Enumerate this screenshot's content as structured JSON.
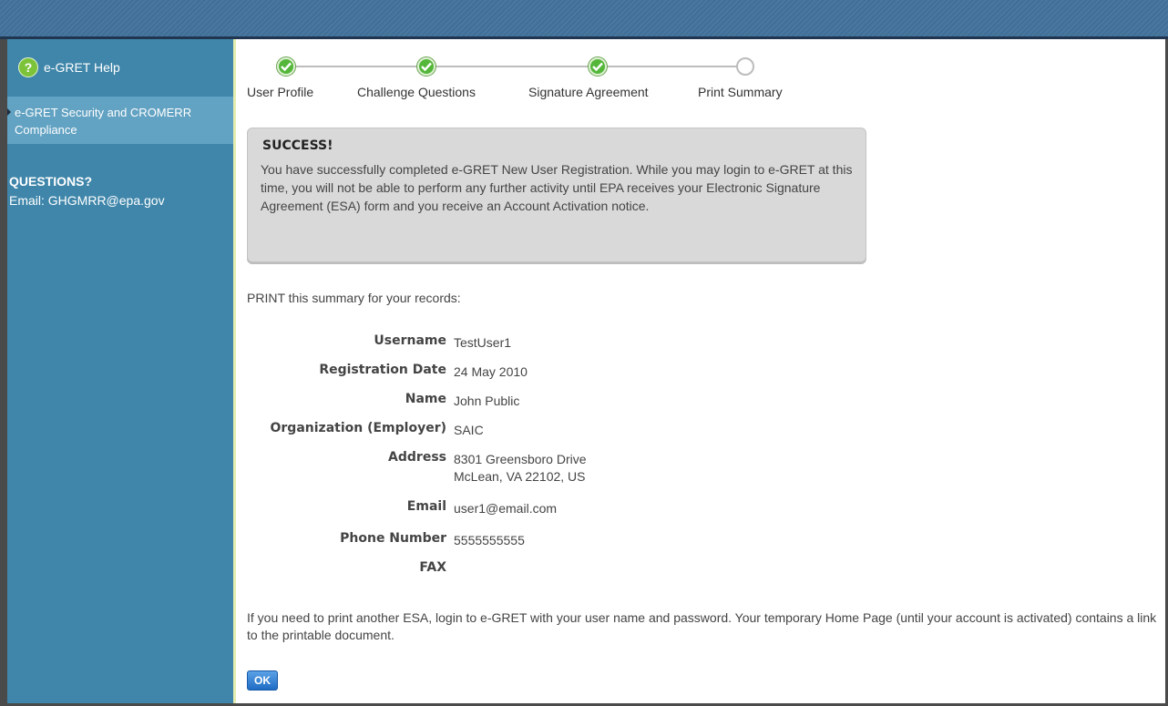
{
  "sidebar": {
    "help_link": "e-GRET Help",
    "security_item": "e-GRET Security and CROMERR Compliance",
    "questions_heading": "QUESTIONS?",
    "email_line": "Email: GHGMRR@epa.gov"
  },
  "steps": [
    {
      "label": "User Profile",
      "status": "complete"
    },
    {
      "label": "Challenge Questions",
      "status": "complete"
    },
    {
      "label": "Signature Agreement",
      "status": "complete"
    },
    {
      "label": "Print Summary",
      "status": "current"
    }
  ],
  "success": {
    "title": "SUCCESS!",
    "message": "You have successfully completed e-GRET New User Registration. While you may login to e-GRET at this time, you will not be able to perform any further activity until EPA receives your Electronic Signature Agreement (ESA) form and you receive an Account Activation notice."
  },
  "print_instruction": "PRINT this summary for your records:",
  "summary": {
    "username": {
      "label": "Username",
      "value": "TestUser1"
    },
    "registration_date": {
      "label": "Registration Date",
      "value": "24 May 2010"
    },
    "name": {
      "label": "Name",
      "value": "John Public"
    },
    "organization": {
      "label": "Organization (Employer)",
      "value": "SAIC"
    },
    "address": {
      "label": "Address",
      "line1": "8301 Greensboro Drive",
      "line2": "McLean, VA 22102, US"
    },
    "email": {
      "label": "Email",
      "value": "user1@email.com"
    },
    "phone": {
      "label": "Phone Number",
      "value": "5555555555"
    },
    "fax": {
      "label": "FAX",
      "value": ""
    }
  },
  "footnote": "If you need to print another ESA, login to e-GRET with your user name and password. Your temporary Home Page (until your account is activated) contains a link to the printable document.",
  "ok_label": "OK",
  "colors": {
    "sidebar": "#3f86aa",
    "success_green": "#54b73a",
    "button_blue": "#1e6cc4"
  }
}
